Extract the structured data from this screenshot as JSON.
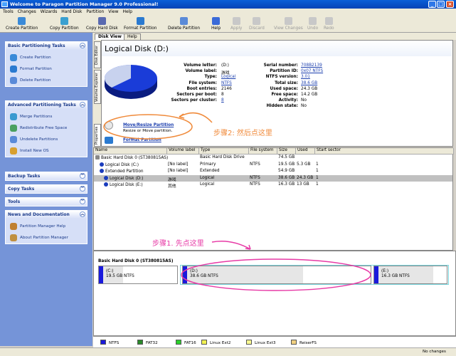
{
  "window": {
    "title": "Welcome to Paragon Partition Manager 9.0 Professional!"
  },
  "menu": [
    "Tools",
    "Changes",
    "Wizards",
    "Hard Disk",
    "Partition",
    "View",
    "Help"
  ],
  "toolbar": [
    {
      "label": "Create Partition",
      "icon": "create-partition-icon",
      "enabled": true
    },
    {
      "label": "Copy Partition",
      "icon": "copy-partition-icon",
      "enabled": true
    },
    {
      "label": "Copy Hard Disk",
      "icon": "copy-hard-disk-icon",
      "enabled": true
    },
    {
      "label": "Format Partition",
      "icon": "format-partition-icon",
      "enabled": true
    },
    {
      "label": "Delete Partition",
      "icon": "delete-partition-icon",
      "enabled": true
    },
    {
      "label": "Help",
      "icon": "help-icon",
      "enabled": true
    },
    {
      "label": "Apply",
      "icon": "apply-icon",
      "enabled": false
    },
    {
      "label": "Discard",
      "icon": "discard-icon",
      "enabled": false
    },
    {
      "label": "View Changes",
      "icon": "view-changes-icon",
      "enabled": false
    },
    {
      "label": "Undo",
      "icon": "undo-icon",
      "enabled": false
    },
    {
      "label": "Redo",
      "icon": "redo-icon",
      "enabled": false
    }
  ],
  "sidebar": {
    "basic": {
      "title": "Basic Partitioning Tasks",
      "items": [
        "Create Partition",
        "Format Partition",
        "Delete Partition"
      ]
    },
    "advanced": {
      "title": "Advanced Partitioning Tasks",
      "items": [
        "Merge Partitions",
        "Redistribute Free Space",
        "Undelete Partitions",
        "Install New OS"
      ]
    },
    "backup": {
      "title": "Backup Tasks"
    },
    "copy": {
      "title": "Copy Tasks"
    },
    "tools": {
      "title": "Tools"
    },
    "news": {
      "title": "News and Documentation",
      "items": [
        "Partition Manager Help",
        "About Partition Manager"
      ]
    }
  },
  "tabs": [
    "Disk View",
    "Help"
  ],
  "vtabs": [
    "Disk Editor",
    "Volume Explorer",
    "Properties"
  ],
  "disk_view": {
    "title": "Logical Disk (D:)",
    "left_fields": [
      {
        "label": "Volume letter:",
        "value": "(D:)"
      },
      {
        "label": "Volume label:",
        "value": "游戏"
      },
      {
        "label": "Type:",
        "value": "Logical",
        "link": true
      },
      {
        "label": "File system:",
        "value": "NTFS",
        "link": true
      },
      {
        "label": "Boot entries:",
        "value": "2146"
      },
      {
        "label": "Sectors per boot:",
        "value": "8"
      },
      {
        "label": "Sectors per cluster:",
        "value": "8",
        "link": true
      }
    ],
    "right_fields": [
      {
        "label": "Serial number:",
        "value": "708B2139",
        "link": true
      },
      {
        "label": "Partition ID:",
        "value": "0x07 NTFS",
        "link": true
      },
      {
        "label": "NTFS version:",
        "value": "3.01",
        "link": true
      },
      {
        "label": "Total size:",
        "value": "38.6 GB",
        "link": true
      },
      {
        "label": "Used space:",
        "value": "24.3 GB"
      },
      {
        "label": "Free space:",
        "value": "14.2 GB"
      },
      {
        "label": "Activity:",
        "value": "No"
      },
      {
        "label": "Hidden state:",
        "value": "No"
      }
    ],
    "pie_used_fraction": 0.63,
    "actions": [
      {
        "title": "Move/Resize Partition",
        "desc": "Resize or Move partition."
      },
      {
        "title": "Format Partition",
        "desc": ""
      }
    ]
  },
  "list": {
    "columns": [
      "Name",
      "Volume label",
      "Type",
      "File system",
      "Size",
      "Used",
      "Start sector"
    ],
    "rows": [
      {
        "name": "Basic Hard Disk 0 (ST380815AS)",
        "label": "",
        "type": "Basic Hard Disk Drive",
        "fs": "",
        "size": "74.5 GB",
        "used": "",
        "start": "",
        "level": 0,
        "selected": false
      },
      {
        "name": "Logical Disk (C:)",
        "label": "[No label]",
        "type": "Primary",
        "fs": "NTFS",
        "size": "19.5 GB",
        "used": "5.3 GB",
        "start": "1",
        "level": 1,
        "selected": false
      },
      {
        "name": "Extended Partition",
        "label": "[No label]",
        "type": "Extended",
        "fs": "",
        "size": "54.9 GB",
        "used": "",
        "start": "1",
        "level": 1,
        "selected": false
      },
      {
        "name": "Logical Disk (D:)",
        "label": "游戏",
        "type": "Logical",
        "fs": "NTFS",
        "size": "38.6 GB",
        "used": "24.3 GB",
        "start": "1",
        "level": 2,
        "selected": true
      },
      {
        "name": "Logical Disk (E:)",
        "label": "其他",
        "type": "Logical",
        "fs": "NTFS",
        "size": "16.3 GB",
        "used": "13 GB",
        "start": "1",
        "level": 2,
        "selected": false
      }
    ]
  },
  "disk_map": {
    "title": "Basic Hard Disk 0 (ST380815AS)",
    "partitions": [
      {
        "letter": "(C:)",
        "info": "19.5 GB NTFS",
        "used_fraction": 0.27
      },
      {
        "letter": "(D:)",
        "info": "38.6 GB NTFS",
        "used_fraction": 0.63
      },
      {
        "letter": "(E:)",
        "info": "16.3 GB NTFS",
        "used_fraction": 0.8
      }
    ]
  },
  "legend": [
    {
      "label": "NTFS",
      "color": "#1a1adc"
    },
    {
      "label": "FAT32",
      "color": "#2a8a2a"
    },
    {
      "label": "FAT16",
      "color": "#2ad02a"
    },
    {
      "label": "Linux Ext2",
      "color": "#f0f050"
    },
    {
      "label": "Linux Ext3",
      "color": "#f8f890"
    },
    {
      "label": "ReiserFS",
      "color": "#f0d080"
    }
  ],
  "status": {
    "changes": "No changes"
  },
  "annotations": {
    "step1": "步骤1. 先点这里",
    "step2": "步骤2: 然后点这里"
  }
}
